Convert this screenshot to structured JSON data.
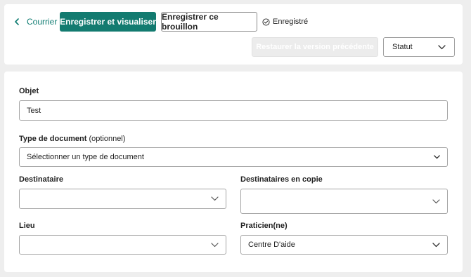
{
  "header": {
    "back_label": "Courrier",
    "save_view_label": "Enregistrer et visualiser",
    "save_draft_label": "Enregistrer ce brouillon",
    "saved_status": "Enregistré",
    "restore_label": "Restaurer la version précédente",
    "status_select": {
      "value": "Statut"
    }
  },
  "form": {
    "subject": {
      "label": "Objet",
      "value": "Test"
    },
    "document_type": {
      "label": "Type de document",
      "optional_note": "(optionnel)",
      "value": "Sélectionner un type de document"
    },
    "recipient": {
      "label": "Destinataire",
      "value": ""
    },
    "cc_recipients": {
      "label": "Destinataires en copie",
      "value": ""
    },
    "place": {
      "label": "Lieu",
      "value": ""
    },
    "practitioner": {
      "label": "Praticien(ne)",
      "value": "Centre D'aide"
    }
  },
  "colors": {
    "accent": "#137b70",
    "page_background": "#eeeeee"
  }
}
